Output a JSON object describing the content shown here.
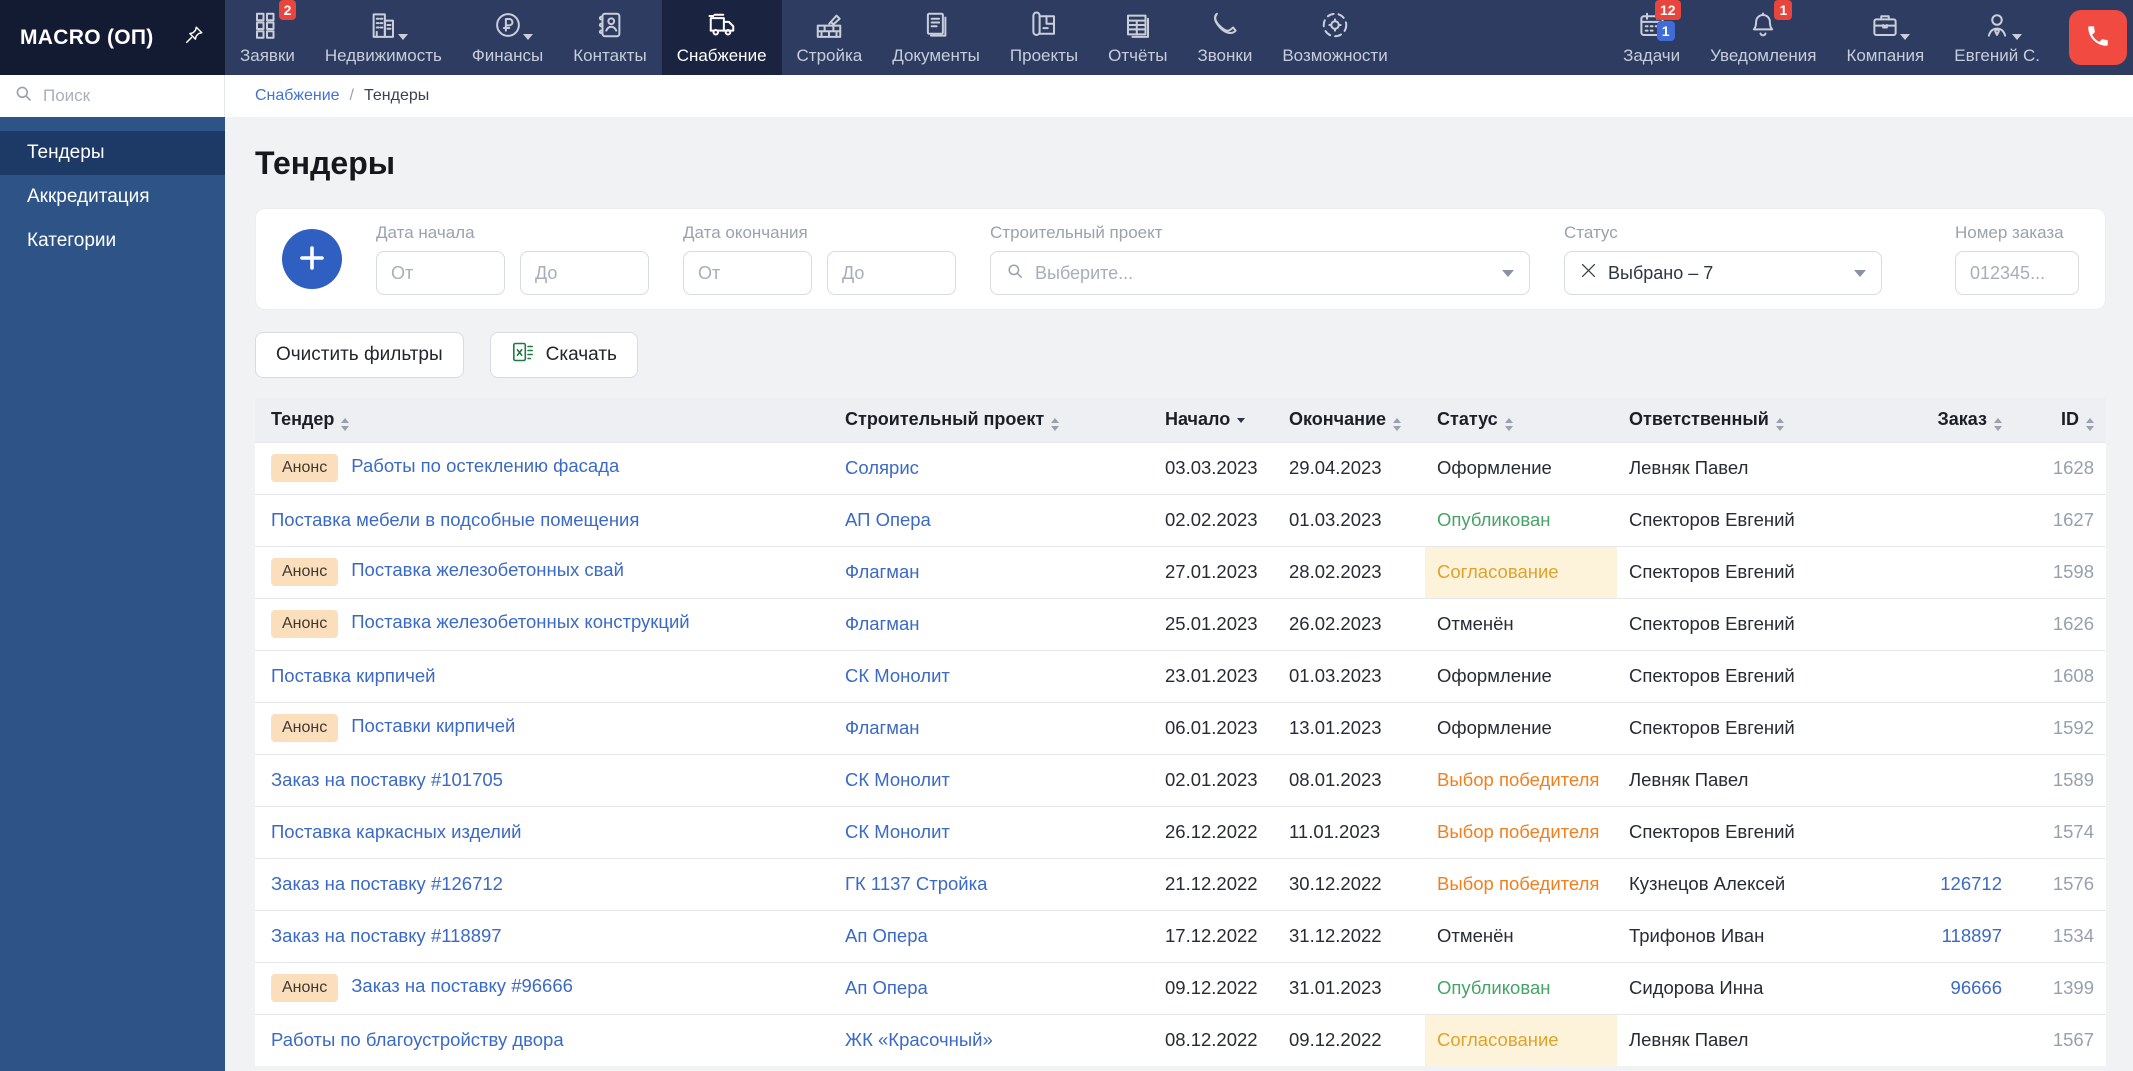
{
  "app": {
    "name": "MACRO (ОП)"
  },
  "topnav": {
    "items": [
      {
        "label": "Заявки",
        "badge": "2"
      },
      {
        "label": "Недвижимость"
      },
      {
        "label": "Финансы"
      },
      {
        "label": "Контакты"
      },
      {
        "label": "Снабжение",
        "active": true
      },
      {
        "label": "Стройка"
      },
      {
        "label": "Документы"
      },
      {
        "label": "Проекты"
      },
      {
        "label": "Отчёты"
      },
      {
        "label": "Звонки"
      },
      {
        "label": "Возможности"
      }
    ],
    "right_items": [
      {
        "label": "Задачи",
        "badge_red": "12",
        "badge_blue": "1"
      },
      {
        "label": "Уведомления",
        "badge_red": "1"
      },
      {
        "label": "Компания"
      },
      {
        "label": "Евгений С."
      }
    ]
  },
  "sidebar": {
    "search_placeholder": "Поиск",
    "items": [
      {
        "label": "Тендеры",
        "active": true
      },
      {
        "label": "Аккредитация"
      },
      {
        "label": "Категории"
      }
    ]
  },
  "breadcrumb": {
    "section": "Снабжение",
    "separator": "/",
    "current": "Тендеры"
  },
  "page": {
    "title": "Тендеры"
  },
  "filters": {
    "date_start": {
      "label": "Дата начала",
      "from_placeholder": "От",
      "to_placeholder": "До"
    },
    "date_end": {
      "label": "Дата окончания",
      "from_placeholder": "От",
      "to_placeholder": "До"
    },
    "project": {
      "label": "Строительный проект",
      "placeholder": "Выберите..."
    },
    "status": {
      "label": "Статус",
      "value": "Выбрано – 7"
    },
    "order": {
      "label": "Номер заказа",
      "placeholder": "012345..."
    }
  },
  "actions": {
    "clear_filters": "Очистить фильтры",
    "download": "Скачать"
  },
  "table": {
    "badge_label": "Анонс",
    "columns": [
      {
        "label": "Тендер",
        "sort": "both"
      },
      {
        "label": "Строительный проект",
        "sort": "both"
      },
      {
        "label": "Начало",
        "sort": "desc"
      },
      {
        "label": "Окончание",
        "sort": "both"
      },
      {
        "label": "Статус",
        "sort": "both"
      },
      {
        "label": "Ответственный",
        "sort": "both"
      },
      {
        "label": "Заказ",
        "sort": "both"
      },
      {
        "label": "ID",
        "sort": "both"
      }
    ],
    "rows": [
      {
        "badge": true,
        "tender": "Работы по остеклению фасада",
        "project": "Солярис",
        "start": "03.03.2023",
        "end": "29.04.2023",
        "status": "Оформление",
        "status_type": "default",
        "responsible": "Левняк Павел",
        "order": "",
        "id": "1628"
      },
      {
        "badge": false,
        "tender": "Поставка мебели в подсобные помещения",
        "project": "АП Опера",
        "start": "02.02.2023",
        "end": "01.03.2023",
        "status": "Опубликован",
        "status_type": "published",
        "responsible": "Спекторов Евгений",
        "order": "",
        "id": "1627"
      },
      {
        "badge": true,
        "tender": "Поставка железобетонных свай",
        "project": "Флагман",
        "start": "27.01.2023",
        "end": "28.02.2023",
        "status": "Согласование",
        "status_type": "approval",
        "responsible": "Спекторов Евгений",
        "order": "",
        "id": "1598"
      },
      {
        "badge": true,
        "tender": "Поставка железобетонных конструкций",
        "project": "Флагман",
        "start": "25.01.2023",
        "end": "26.02.2023",
        "status": "Отменён",
        "status_type": "default",
        "responsible": "Спекторов Евгений",
        "order": "",
        "id": "1626"
      },
      {
        "badge": false,
        "tender": "Поставка кирпичей",
        "project": "СК Монолит",
        "start": "23.01.2023",
        "end": "01.03.2023",
        "status": "Оформление",
        "status_type": "default",
        "responsible": "Спекторов Евгений",
        "order": "",
        "id": "1608"
      },
      {
        "badge": true,
        "tender": "Поставки кирпичей",
        "project": "Флагман",
        "start": "06.01.2023",
        "end": "13.01.2023",
        "status": "Оформление",
        "status_type": "default",
        "responsible": "Спекторов Евгений",
        "order": "",
        "id": "1592"
      },
      {
        "badge": false,
        "tender": "Заказ на поставку #101705",
        "project": "СК Монолит",
        "start": "02.01.2023",
        "end": "08.01.2023",
        "status": "Выбор победителя",
        "status_type": "winner",
        "responsible": "Левняк Павел",
        "order": "",
        "id": "1589"
      },
      {
        "badge": false,
        "tender": "Поставка каркасных изделий",
        "project": "СК Монолит",
        "start": "26.12.2022",
        "end": "11.01.2023",
        "status": "Выбор победителя",
        "status_type": "winner",
        "responsible": "Спекторов Евгений",
        "order": "",
        "id": "1574"
      },
      {
        "badge": false,
        "tender": "Заказ на поставку #126712",
        "project": "ГК 1137 Стройка",
        "start": "21.12.2022",
        "end": "30.12.2022",
        "status": "Выбор победителя",
        "status_type": "winner",
        "responsible": "Кузнецов Алексей",
        "order": "126712",
        "id": "1576"
      },
      {
        "badge": false,
        "tender": "Заказ на поставку #118897",
        "project": "Ап Опера",
        "start": "17.12.2022",
        "end": "31.12.2022",
        "status": "Отменён",
        "status_type": "default",
        "responsible": "Трифонов Иван",
        "order": "118897",
        "id": "1534"
      },
      {
        "badge": true,
        "tender": "Заказ на поставку #96666",
        "project": "Ап Опера",
        "start": "09.12.2022",
        "end": "31.01.2023",
        "status": "Опубликован",
        "status_type": "published",
        "responsible": "Сидорова Инна",
        "order": "96666",
        "id": "1399"
      },
      {
        "badge": false,
        "tender": "Работы по благоустройству двора",
        "project": "ЖК «Красочный»",
        "start": "08.12.2022",
        "end": "09.12.2022",
        "status": "Согласование",
        "status_type": "approval",
        "responsible": "Левняк Павел",
        "order": "",
        "id": "1567"
      }
    ]
  },
  "colors": {
    "accent_blue": "#2f5fc0",
    "link_blue": "#3b6ac6",
    "status_published_green": "#47a368",
    "status_approval_amber": "#dfa32c",
    "status_approval_bg": "#fcf3da",
    "status_winner_orange": "#f0801f",
    "announce_badge_bg": "#fbdfbd",
    "nav_badge_red": "#e8453c",
    "nav_badge_blue": "#3f6cd6",
    "call_button_red": "#f04a41"
  }
}
